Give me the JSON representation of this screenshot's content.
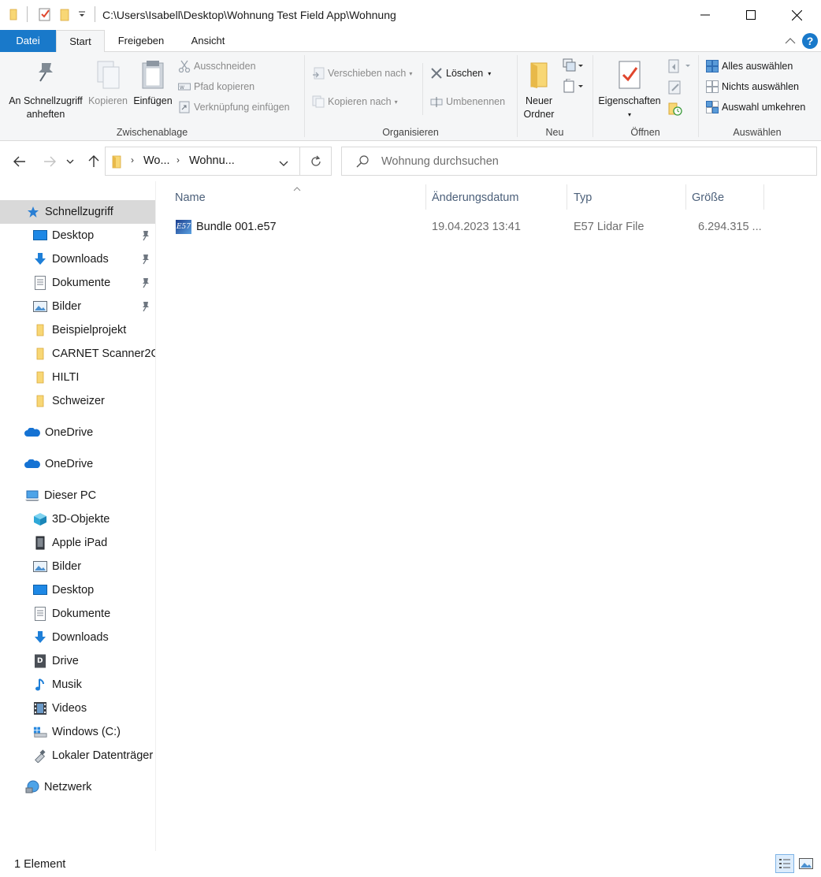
{
  "window": {
    "path": "C:\\Users\\Isabell\\Desktop\\Wohnung Test Field App\\Wohnung"
  },
  "tabs": {
    "file": "Datei",
    "start": "Start",
    "share": "Freigeben",
    "view": "Ansicht"
  },
  "ribbon": {
    "clipboard": {
      "pin_line1": "An Schnellzugriff",
      "pin_line2": "anheften",
      "copy": "Kopieren",
      "paste": "Einfügen",
      "cut": "Ausschneiden",
      "copy_path": "Pfad kopieren",
      "paste_shortcut": "Verknüpfung einfügen",
      "label": "Zwischenablage"
    },
    "organize": {
      "move_to": "Verschieben nach",
      "copy_to": "Kopieren nach",
      "delete": "Löschen",
      "rename": "Umbenennen",
      "label": "Organisieren"
    },
    "new": {
      "new_folder_line1": "Neuer",
      "new_folder_line2": "Ordner",
      "label": "Neu"
    },
    "open": {
      "properties": "Eigenschaften",
      "label": "Öffnen"
    },
    "select": {
      "select_all": "Alles auswählen",
      "select_none": "Nichts auswählen",
      "invert": "Auswahl umkehren",
      "label": "Auswählen"
    }
  },
  "address": {
    "crumb1": "Wo...",
    "crumb2": "Wohnu...",
    "search_placeholder": "Wohnung durchsuchen"
  },
  "nav": {
    "quick_access": "Schnellzugriff",
    "desktop": "Desktop",
    "downloads": "Downloads",
    "documents": "Dokumente",
    "pictures": "Bilder",
    "beispielprojekt": "Beispielprojekt",
    "carnet": "CARNET Scanner2G",
    "hilti": "HILTI",
    "schweizer": "Schweizer",
    "onedrive1": "OneDrive",
    "onedrive2": "OneDrive",
    "this_pc": "Dieser PC",
    "objects3d": "3D-Objekte",
    "ipad": "Apple iPad",
    "pc_pictures": "Bilder",
    "pc_desktop": "Desktop",
    "pc_documents": "Dokumente",
    "pc_downloads": "Downloads",
    "drive": "Drive",
    "music": "Musik",
    "videos": "Videos",
    "windows_c": "Windows (C:)",
    "local_disk": "Lokaler Datenträger",
    "network": "Netzwerk"
  },
  "columns": {
    "name": "Name",
    "date": "Änderungsdatum",
    "type": "Typ",
    "size": "Größe"
  },
  "files": [
    {
      "name": "Bundle 001.e57",
      "date": "19.04.2023 13:41",
      "type": "E57 Lidar File",
      "size": "6.294.315 ...",
      "icon": "e57-file-icon"
    }
  ],
  "status": {
    "count": "1 Element"
  },
  "colors": {
    "accent": "#1979ca",
    "folder": "#f8d775",
    "selection": "#d9d9d9"
  }
}
